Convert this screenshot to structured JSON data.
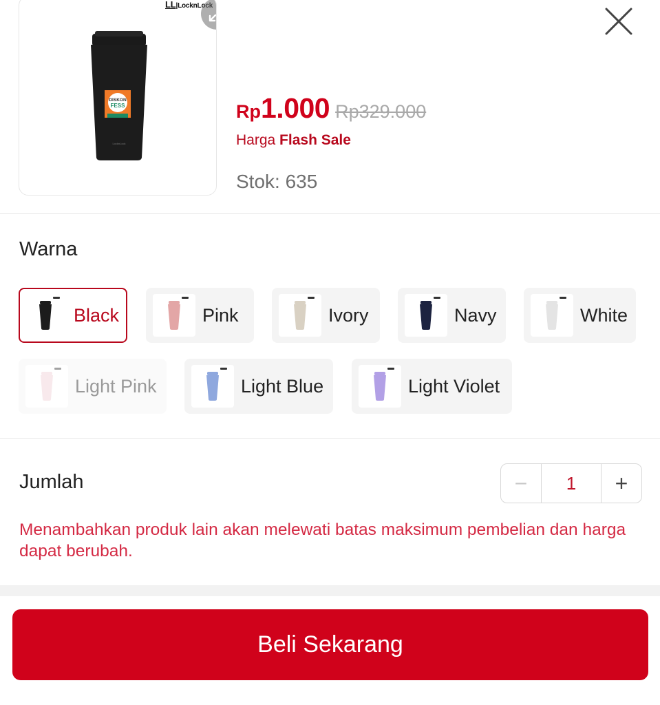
{
  "product": {
    "brand_logo": "LL LocknLock",
    "image_badge": "DISKON FESS"
  },
  "price": {
    "currency": "Rp",
    "current": "1.000",
    "original": "Rp329.000",
    "label_prefix": "Harga",
    "label_emphasis": "Flash Sale"
  },
  "stock": {
    "text": "Stok: 635"
  },
  "variants": {
    "title": "Warna",
    "options": [
      {
        "label": "Black",
        "color": "#1c1c1c",
        "selected": true,
        "disabled": false
      },
      {
        "label": "Pink",
        "color": "#e3a6a6",
        "selected": false,
        "disabled": false
      },
      {
        "label": "Ivory",
        "color": "#d9d1c3",
        "selected": false,
        "disabled": false
      },
      {
        "label": "Navy",
        "color": "#1d2340",
        "selected": false,
        "disabled": false
      },
      {
        "label": "White",
        "color": "#e4e4e4",
        "selected": false,
        "disabled": false
      },
      {
        "label": "Light Pink",
        "color": "#f1cfd6",
        "selected": false,
        "disabled": true
      },
      {
        "label": "Light Blue",
        "color": "#8fa8de",
        "selected": false,
        "disabled": false
      },
      {
        "label": "Light Violet",
        "color": "#b2a0e6",
        "selected": false,
        "disabled": false
      }
    ]
  },
  "quantity": {
    "title": "Jumlah",
    "value": "1",
    "minus_symbol": "−",
    "plus_symbol": "+"
  },
  "warning": {
    "text": "Menambahkan produk lain akan melewati batas maksimum pembelian dan harga dapat berubah."
  },
  "buy_button": {
    "label": "Beli Sekarang"
  },
  "icons": {
    "close": "close-icon",
    "zoom": "expand-icon"
  },
  "colors": {
    "accent": "#d0021b",
    "accent_dark": "#b8081d",
    "warning_text": "#d42a44",
    "muted_text": "#6f6f6f"
  }
}
